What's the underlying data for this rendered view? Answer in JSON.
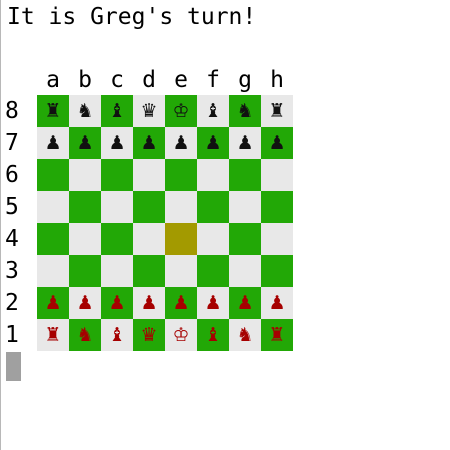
{
  "status_text": "It is Greg's turn!",
  "files": [
    "a",
    "b",
    "c",
    "d",
    "e",
    "f",
    "g",
    "h"
  ],
  "ranks": [
    "8",
    "7",
    "6",
    "5",
    "4",
    "3",
    "2",
    "1"
  ],
  "colors": {
    "light_square": "#e8e8e8",
    "dark_square": "#22a806",
    "highlight_square": "#a39a00",
    "black_pieces": "#111111",
    "red_pieces": "#a60000"
  },
  "highlighted_squares": [
    "e4"
  ],
  "pieces": {
    "a8": {
      "glyph": "♜",
      "name": "rook",
      "side": "black"
    },
    "b8": {
      "glyph": "♞",
      "name": "knight",
      "side": "black"
    },
    "c8": {
      "glyph": "♝",
      "name": "bishop",
      "side": "black"
    },
    "d8": {
      "glyph": "♛",
      "name": "queen",
      "side": "black"
    },
    "e8": {
      "glyph": "♔",
      "name": "king",
      "side": "black"
    },
    "f8": {
      "glyph": "♝",
      "name": "bishop",
      "side": "black"
    },
    "g8": {
      "glyph": "♞",
      "name": "knight",
      "side": "black"
    },
    "h8": {
      "glyph": "♜",
      "name": "rook",
      "side": "black"
    },
    "a7": {
      "glyph": "♟",
      "name": "pawn",
      "side": "black"
    },
    "b7": {
      "glyph": "♟",
      "name": "pawn",
      "side": "black"
    },
    "c7": {
      "glyph": "♟",
      "name": "pawn",
      "side": "black"
    },
    "d7": {
      "glyph": "♟",
      "name": "pawn",
      "side": "black"
    },
    "e7": {
      "glyph": "♟",
      "name": "pawn",
      "side": "black"
    },
    "f7": {
      "glyph": "♟",
      "name": "pawn",
      "side": "black"
    },
    "g7": {
      "glyph": "♟",
      "name": "pawn",
      "side": "black"
    },
    "h7": {
      "glyph": "♟",
      "name": "pawn",
      "side": "black"
    },
    "a2": {
      "glyph": "♟",
      "name": "pawn",
      "side": "red"
    },
    "b2": {
      "glyph": "♟",
      "name": "pawn",
      "side": "red"
    },
    "c2": {
      "glyph": "♟",
      "name": "pawn",
      "side": "red"
    },
    "d2": {
      "glyph": "♟",
      "name": "pawn",
      "side": "red"
    },
    "e2": {
      "glyph": "♟",
      "name": "pawn",
      "side": "red"
    },
    "f2": {
      "glyph": "♟",
      "name": "pawn",
      "side": "red"
    },
    "g2": {
      "glyph": "♟",
      "name": "pawn",
      "side": "red"
    },
    "h2": {
      "glyph": "♟",
      "name": "pawn",
      "side": "red"
    },
    "a1": {
      "glyph": "♜",
      "name": "rook",
      "side": "red"
    },
    "b1": {
      "glyph": "♞",
      "name": "knight",
      "side": "red"
    },
    "c1": {
      "glyph": "♝",
      "name": "bishop",
      "side": "red"
    },
    "d1": {
      "glyph": "♛",
      "name": "queen",
      "side": "red"
    },
    "e1": {
      "glyph": "♔",
      "name": "king",
      "side": "red"
    },
    "f1": {
      "glyph": "♝",
      "name": "bishop",
      "side": "red"
    },
    "g1": {
      "glyph": "♞",
      "name": "knight",
      "side": "red"
    },
    "h1": {
      "glyph": "♜",
      "name": "rook",
      "side": "red"
    }
  }
}
